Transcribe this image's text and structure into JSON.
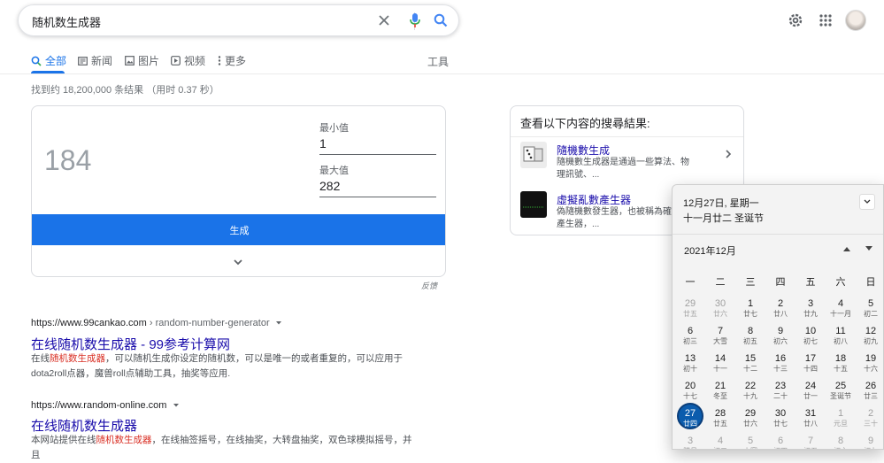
{
  "search": {
    "query": "随机数生成器"
  },
  "tabs": [
    {
      "label": "全部",
      "icon": "search-icon",
      "active": true
    },
    {
      "label": "新闻",
      "icon": "newspaper-icon"
    },
    {
      "label": "图片",
      "icon": "image-icon"
    },
    {
      "label": "视频",
      "icon": "play-icon"
    },
    {
      "label": "更多",
      "icon": "more-vert-icon"
    }
  ],
  "tools_label": "工具",
  "stats": "找到约 18,200,000 条结果 （用时 0.37 秒）",
  "rng": {
    "result": "184",
    "min_label": "最小值",
    "min_value": "1",
    "max_label": "最大值",
    "max_value": "282",
    "button_label": "生成",
    "feedback": "反馈"
  },
  "results": [
    {
      "url": "https://www.99cankao.com",
      "crumb": " › random-number-generator",
      "title": "在线随机数生成器 - 99参考计算网",
      "snippet_pre": "在线",
      "snippet_hl": "随机数生成器",
      "snippet_post": "，可以随机生成你设定的随机数，可以是唯一的或者重复的，可以应用于",
      "snippet_line2": "dota2roll点器，魔兽roll点辅助工具，抽奖等应用."
    },
    {
      "url": "https://www.random-online.com",
      "crumb": "",
      "title": "在线随机数生成器",
      "snippet_pre": "本网站提供在线",
      "snippet_hl": "随机数生成器",
      "snippet_post": "，在线抽签摇号，在线抽奖，大转盘抽奖，双色球模拟摇号，并且",
      "snippet_line2": ""
    }
  ],
  "side": {
    "heading": "查看以下内容的搜尋結果:",
    "items": [
      {
        "title": "隨機數生成",
        "desc": "隨機數生成器是通過一些算法、物理訊號、..."
      },
      {
        "title": "虛擬亂數產生器",
        "desc": "偽隨機數發生器，也被稱為確定位產生器，..."
      }
    ]
  },
  "calendar": {
    "date_line": "12月27日, 星期一",
    "lunar_line": "十一月廿二 圣诞节",
    "month_label": "2021年12月",
    "weekdays": [
      "一",
      "二",
      "三",
      "四",
      "五",
      "六",
      "日"
    ],
    "weeks": [
      [
        {
          "n": "29",
          "l": "廿五",
          "o": true
        },
        {
          "n": "30",
          "l": "廿六",
          "o": true
        },
        {
          "n": "1",
          "l": "廿七"
        },
        {
          "n": "2",
          "l": "廿八"
        },
        {
          "n": "3",
          "l": "廿九"
        },
        {
          "n": "4",
          "l": "十一月"
        },
        {
          "n": "5",
          "l": "初二"
        }
      ],
      [
        {
          "n": "6",
          "l": "初三"
        },
        {
          "n": "7",
          "l": "大雪"
        },
        {
          "n": "8",
          "l": "初五"
        },
        {
          "n": "9",
          "l": "初六"
        },
        {
          "n": "10",
          "l": "初七"
        },
        {
          "n": "11",
          "l": "初八"
        },
        {
          "n": "12",
          "l": "初九"
        }
      ],
      [
        {
          "n": "13",
          "l": "初十"
        },
        {
          "n": "14",
          "l": "十一"
        },
        {
          "n": "15",
          "l": "十二"
        },
        {
          "n": "16",
          "l": "十三"
        },
        {
          "n": "17",
          "l": "十四"
        },
        {
          "n": "18",
          "l": "十五"
        },
        {
          "n": "19",
          "l": "十六"
        }
      ],
      [
        {
          "n": "20",
          "l": "十七"
        },
        {
          "n": "21",
          "l": "冬至"
        },
        {
          "n": "22",
          "l": "十九"
        },
        {
          "n": "23",
          "l": "二十"
        },
        {
          "n": "24",
          "l": "廿一"
        },
        {
          "n": "25",
          "l": "圣诞节"
        },
        {
          "n": "26",
          "l": "廿三"
        }
      ],
      [
        {
          "n": "27",
          "l": "廿四",
          "today": true
        },
        {
          "n": "28",
          "l": "廿五"
        },
        {
          "n": "29",
          "l": "廿六"
        },
        {
          "n": "30",
          "l": "廿七"
        },
        {
          "n": "31",
          "l": "廿八"
        },
        {
          "n": "1",
          "l": "元旦",
          "o": true
        },
        {
          "n": "2",
          "l": "三十",
          "o": true
        }
      ],
      [
        {
          "n": "3",
          "l": "腊月",
          "o": true
        },
        {
          "n": "4",
          "l": "初二",
          "o": true
        },
        {
          "n": "5",
          "l": "小寒",
          "o": true
        },
        {
          "n": "6",
          "l": "初四",
          "o": true
        },
        {
          "n": "7",
          "l": "初五",
          "o": true
        },
        {
          "n": "8",
          "l": "初六",
          "o": true
        },
        {
          "n": "9",
          "l": "初七",
          "o": true
        }
      ]
    ]
  },
  "colors": {
    "accent": "#1a73e8",
    "link": "#1a0dab",
    "highlight": "#d93025",
    "today": "#0b5cad"
  }
}
